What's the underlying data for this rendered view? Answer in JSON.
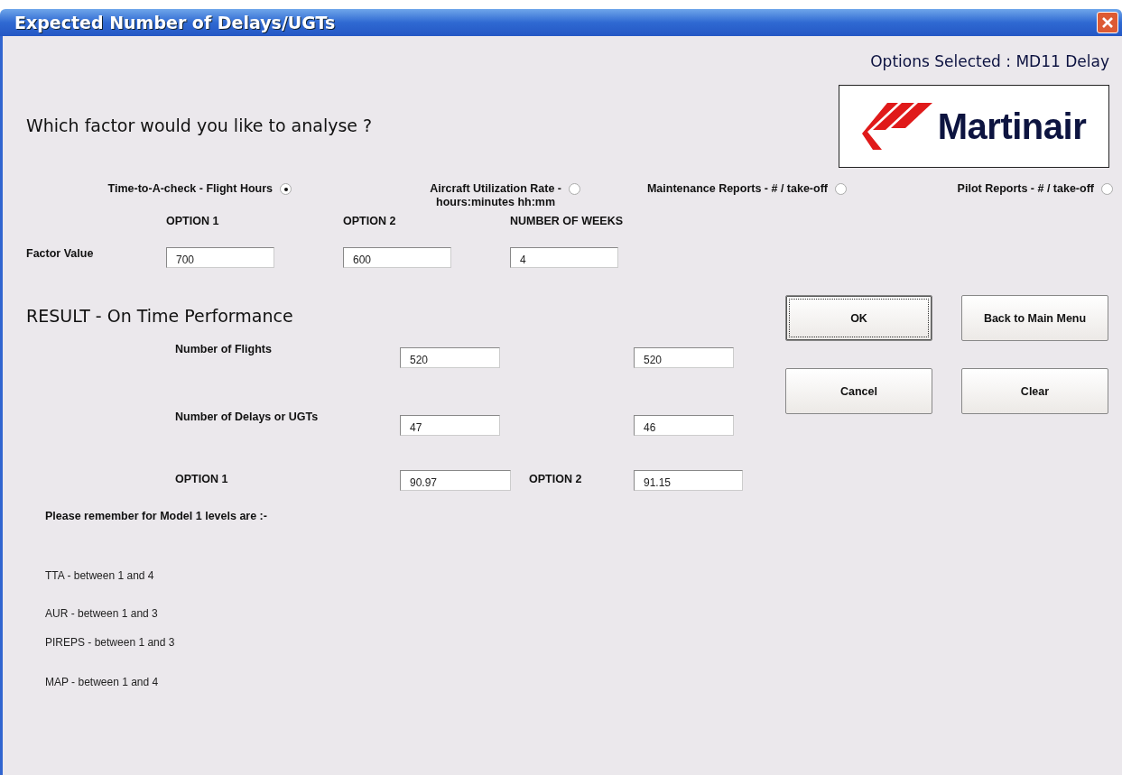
{
  "window": {
    "title": "Expected Number of Delays/UGTs"
  },
  "options_selected": "Options Selected : MD11 Delay",
  "logo": {
    "text": "Martinair"
  },
  "question": "Which factor would you like to analyse ?",
  "factors": [
    {
      "label": "Time-to-A-check - Flight Hours",
      "selected": true
    },
    {
      "label": "Aircraft Utilization Rate -\nhours:minutes hh:mm",
      "selected": false
    },
    {
      "label": "Maintenance Reports - # / take-off",
      "selected": false
    },
    {
      "label": "Pilot Reports - # / take-off",
      "selected": false
    }
  ],
  "factor_inputs": {
    "label": "Factor Value",
    "columns": [
      {
        "heading": "OPTION 1",
        "value": "700"
      },
      {
        "heading": "OPTION 2",
        "value": "600"
      },
      {
        "heading": "NUMBER OF WEEKS",
        "value": "4"
      }
    ]
  },
  "result": {
    "title": "RESULT - On Time Performance",
    "rows": [
      {
        "label": "Number of Flights",
        "option_1": "520",
        "option_2": "520"
      },
      {
        "label": "Number of Delays or UGTs",
        "option_1": "47",
        "option_2": "46"
      },
      {
        "label": "OPTION 1",
        "option_1": "90.97",
        "middle_label": "OPTION 2",
        "option_2": "91.15"
      }
    ]
  },
  "buttons": [
    {
      "label": "OK",
      "focused": true
    },
    {
      "label": "Back to Main Menu",
      "focused": false
    },
    {
      "label": "Cancel",
      "focused": false
    },
    {
      "label": "Clear",
      "focused": false
    }
  ],
  "notes": {
    "heading": "Please remember for Model 1 levels are :-",
    "lines": [
      "TTA - between 1 and 4",
      "AUR - between 1 and 3",
      "PIREPS - between 1 and 3",
      "MAP - between 1 and 4"
    ]
  }
}
